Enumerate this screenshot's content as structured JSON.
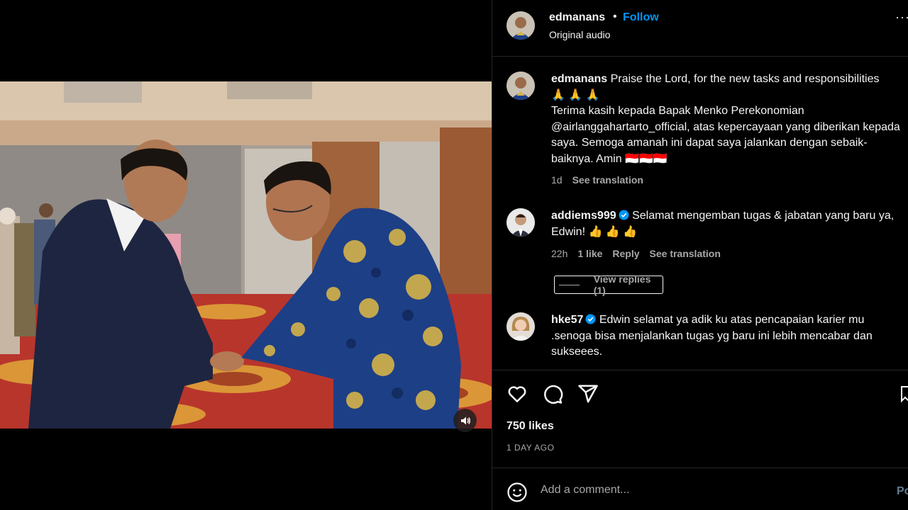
{
  "post": {
    "username": "edmanans",
    "follow_label": "Follow",
    "separator": "•",
    "audio_label": "Original audio",
    "more_glyph": "···",
    "caption_user": "edmanans",
    "caption_line1": "Praise the Lord, for the new tasks and responsibilities",
    "caption_emoji": "🙏 🙏 🙏",
    "caption_body": "Terima kasih kepada Bapak Menko Perekonomian @airlanggahartarto_official, atas kepercayaan yang diberikan kepada saya. Semoga amanah ini dapat saya jalankan dengan sebaik-baiknya. Amin 🇮🇩🇮🇩🇮🇩",
    "caption_age": "1d",
    "caption_translate": "See translation",
    "likes": "750 likes",
    "posted_ago": "1 DAY AGO"
  },
  "comments": [
    {
      "username": "addiems999",
      "verified": true,
      "text": "Selamat mengemban tugas & jabatan yang baru ya, Edwin! 👍 👍 👍",
      "age": "22h",
      "likes": "1 like",
      "reply": "Reply",
      "translate": "See translation",
      "view_replies": "View replies (1)"
    },
    {
      "username": "hke57",
      "verified": true,
      "text": "Edwin selamat ya adik ku atas pencapaian karier mu .senoga bisa menjalankan tugas yg baru ini lebih mencabar dan sukseees."
    }
  ],
  "compose": {
    "placeholder": "Add a comment...",
    "post_label": "Post"
  },
  "colors": {
    "accent": "#0095f6",
    "background": "#000000",
    "muted_text": "#a8a8a8",
    "divider": "#262626"
  },
  "icons": [
    "speaker-icon",
    "more-icon",
    "verified-badge-icon",
    "heart-icon",
    "comment-icon",
    "share-icon",
    "bookmark-icon",
    "emoji-icon"
  ]
}
